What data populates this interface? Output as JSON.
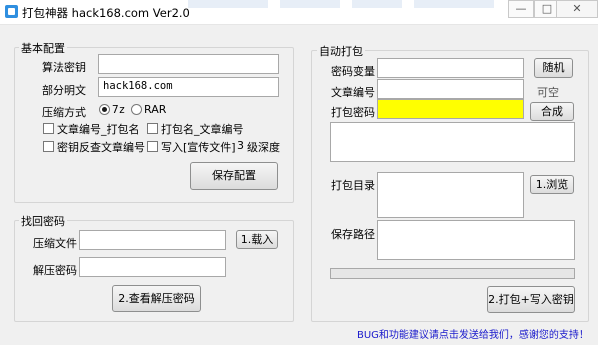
{
  "window": {
    "title": "打包神器 hack168.com Ver2.0",
    "minimize": "—",
    "maximize": "□",
    "close": "✕"
  },
  "basic": {
    "title": "基本配置",
    "algo_label": "算法密钥",
    "algo_value": "",
    "plain_label": "部分明文",
    "plain_value": "hack168.com",
    "compress_label": "压缩方式",
    "opt_7z": "7z",
    "opt_rar": "RAR",
    "selected": "7z",
    "chk1": "文章编号_打包名",
    "chk2": "打包名_文章编号",
    "chk3": "密钥反查文章编号",
    "chk4": "写入[宣传文件]",
    "depth_value": "3",
    "depth_suffix": "级深度",
    "save_btn": "保存配置"
  },
  "recover": {
    "title": "找回密码",
    "file_label": "压缩文件",
    "file_value": "",
    "load_btn": "1.载入",
    "pwd_label": "解压密码",
    "pwd_value": "",
    "view_btn": "2.查看解压密码"
  },
  "auto": {
    "title": "自动打包",
    "var_label": "密码变量",
    "var_value": "",
    "random_btn": "随机",
    "num_label": "文章编号",
    "num_value": "",
    "num_hint": "可空",
    "pack_label": "打包密码",
    "pack_value": "",
    "combine_btn": "合成",
    "dir_label": "打包目录",
    "browse_btn": "1.浏览",
    "save_label": "保存路径",
    "pack_btn": "2.打包+写入密钥"
  },
  "footer": "BUG和功能建议请点击发送给我们，感谢您的支持！",
  "colors": {
    "yellow_field": "#ffff00",
    "footer_link": "#1a1acc"
  }
}
